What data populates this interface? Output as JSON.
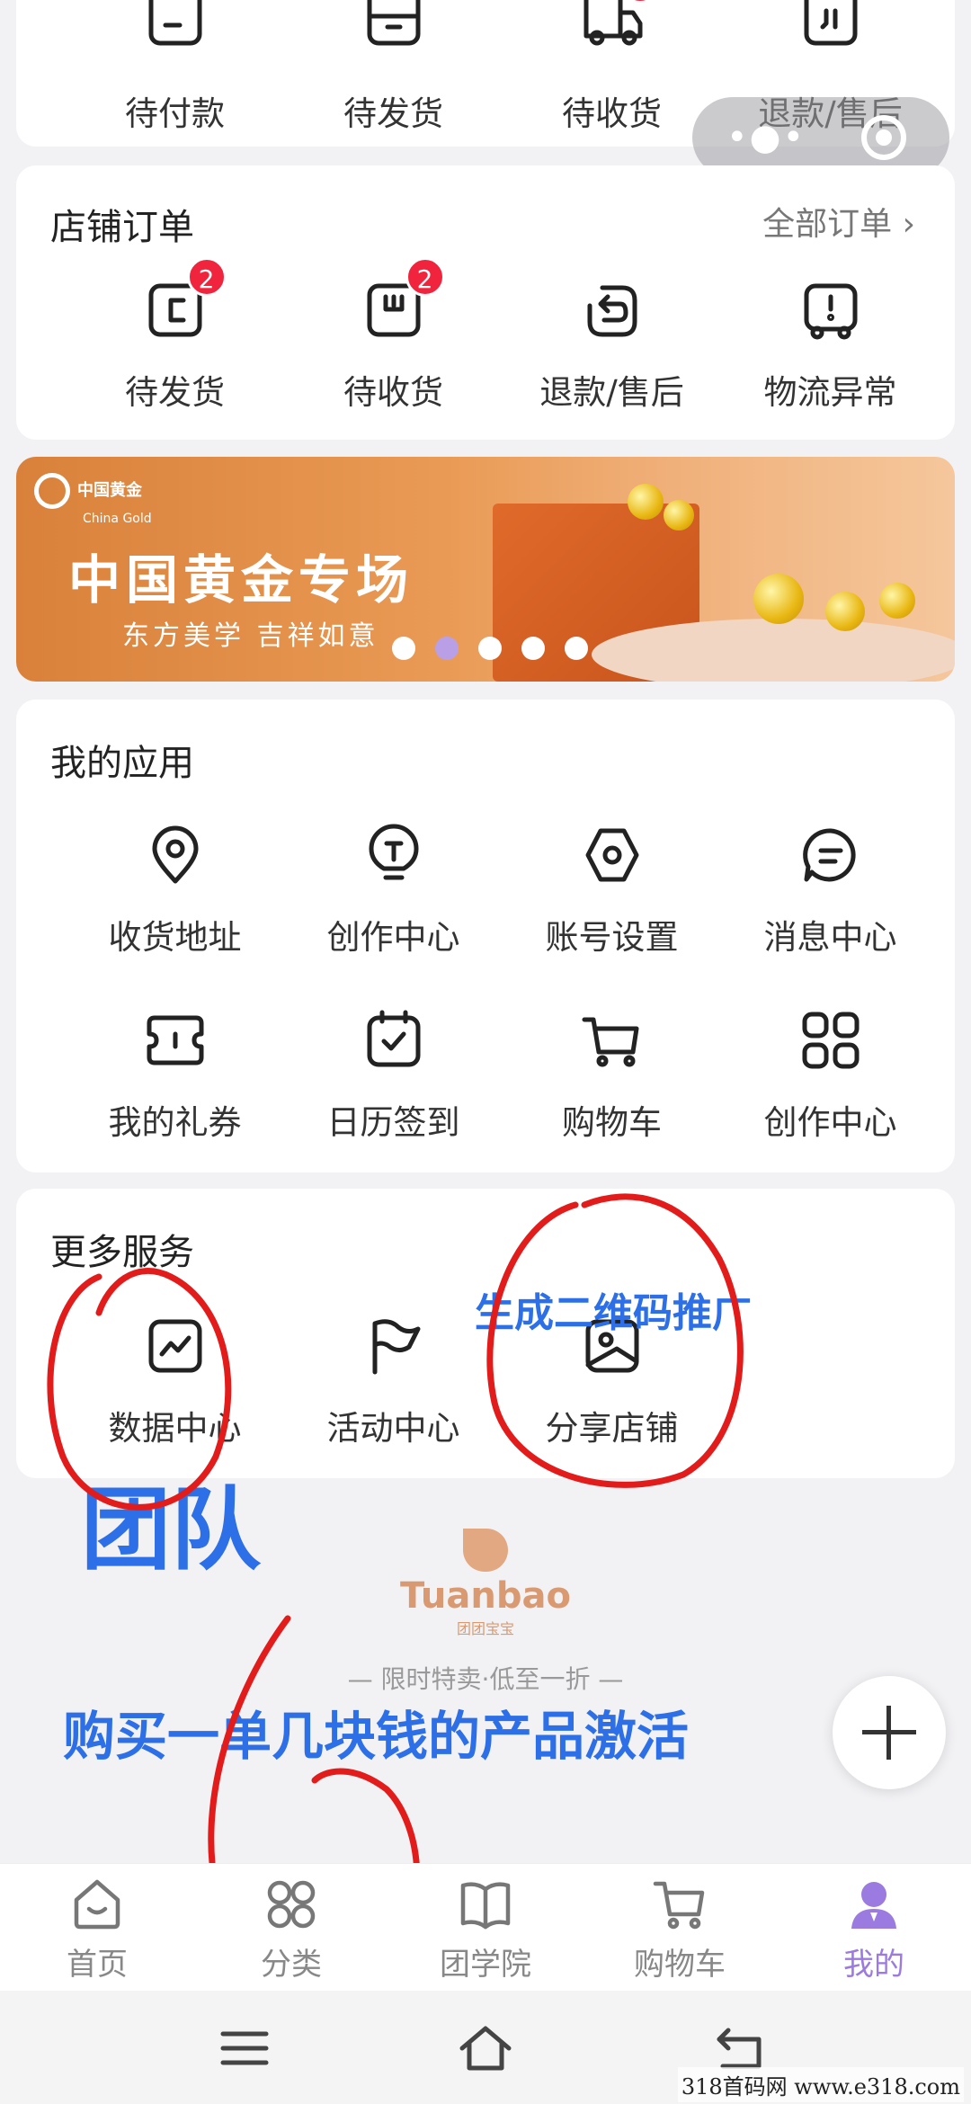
{
  "top_orders": {
    "items": [
      {
        "label": "待付款"
      },
      {
        "label": "待发货"
      },
      {
        "label": "待收货"
      },
      {
        "label": "退款/售后"
      }
    ]
  },
  "capsule": {
    "more_icon": "more-dots-icon",
    "close_icon": "target-icon"
  },
  "shop_orders": {
    "title": "店铺订单",
    "all_link": "全部订单 ›",
    "items": [
      {
        "label": "待发货",
        "badge": "2"
      },
      {
        "label": "待收货",
        "badge": "2"
      },
      {
        "label": "退款/售后"
      },
      {
        "label": "物流异常"
      }
    ]
  },
  "banner": {
    "logo_cn": "中国黄金",
    "logo_en": "China Gold",
    "title": "中国黄金专场",
    "subtitle": "东方美学 吉祥如意",
    "slide_count": 5,
    "active_slide": 2
  },
  "my_apps": {
    "title": "我的应用",
    "items": [
      {
        "label": "收货地址",
        "icon": "location-pin-icon"
      },
      {
        "label": "创作中心",
        "icon": "lightbulb-icon"
      },
      {
        "label": "账号设置",
        "icon": "hexagon-settings-icon"
      },
      {
        "label": "消息中心",
        "icon": "message-bubble-icon"
      },
      {
        "label": "我的礼券",
        "icon": "coupon-icon"
      },
      {
        "label": "日历签到",
        "icon": "calendar-check-icon"
      },
      {
        "label": "购物车",
        "icon": "cart-icon"
      },
      {
        "label": "创作中心",
        "icon": "grid-icon"
      }
    ]
  },
  "more_services": {
    "title": "更多服务",
    "items": [
      {
        "label": "数据中心",
        "icon": "chart-icon"
      },
      {
        "label": "活动中心",
        "icon": "flag-icon"
      },
      {
        "label": "分享店铺",
        "icon": "share-image-icon"
      }
    ]
  },
  "annotations": {
    "qr": "生成二维码推广",
    "team": "团队",
    "activate": "购买一单几块钱的产品激活"
  },
  "brand": {
    "name": "Tuanbao",
    "name_cn": "团团宝宝",
    "slogan": "— 限时特卖·低至一折 —"
  },
  "tabbar": {
    "items": [
      {
        "label": "首页"
      },
      {
        "label": "分类"
      },
      {
        "label": "团学院"
      },
      {
        "label": "购物车"
      },
      {
        "label": "我的"
      }
    ]
  },
  "watermark": "318首码网  www.e318.com",
  "colors": {
    "accent": "#9b7be0",
    "badge": "#f0243d",
    "annotation_blue": "#2c6fe6",
    "annotation_red": "#e21b1b"
  }
}
